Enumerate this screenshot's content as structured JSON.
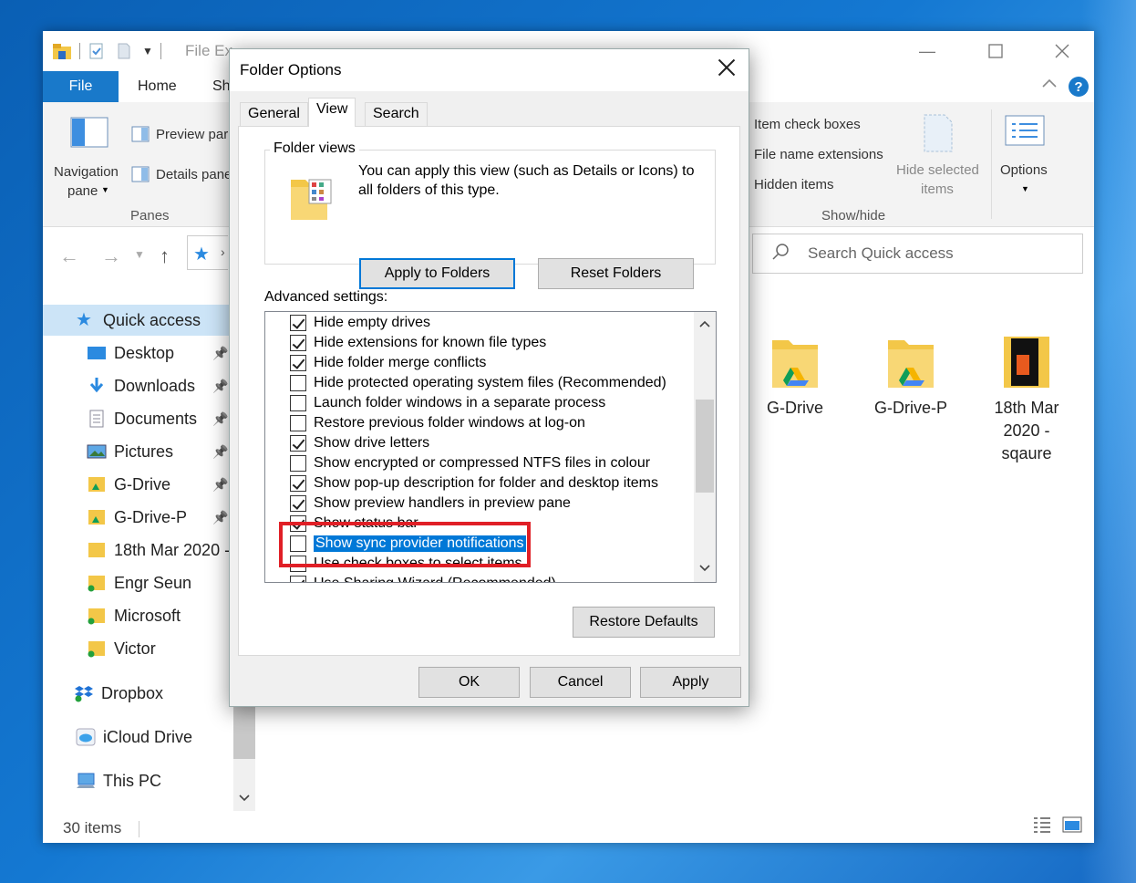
{
  "explorer": {
    "title": "File Ex",
    "tabs": {
      "file": "File",
      "home": "Home",
      "share": "Sh"
    },
    "ribbon": {
      "navigation_pane": "Navigation",
      "navigation_pane_2": "pane",
      "preview_pane": "Preview par",
      "details_pane": "Details pane",
      "panes_group": "Panes",
      "item_check_boxes": "Item check boxes",
      "file_name_extensions": "File name extensions",
      "hidden_items": "Hidden items",
      "hide_selected": "Hide selected",
      "hide_selected_2": "items",
      "options": "Options",
      "showhide_group": "Show/hide"
    },
    "search_placeholder": "Search Quick access",
    "nav": {
      "quick_access": "Quick access",
      "items": [
        {
          "label": "Desktop",
          "pinned": true
        },
        {
          "label": "Downloads",
          "pinned": true
        },
        {
          "label": "Documents",
          "pinned": true
        },
        {
          "label": "Pictures",
          "pinned": true
        },
        {
          "label": "G-Drive",
          "pinned": true
        },
        {
          "label": "G-Drive-P",
          "pinned": true
        },
        {
          "label": "18th Mar 2020 -",
          "pinned": false
        },
        {
          "label": "Engr Seun",
          "pinned": false
        },
        {
          "label": "Microsoft",
          "pinned": false
        },
        {
          "label": "Victor",
          "pinned": false
        }
      ],
      "dropbox": "Dropbox",
      "icloud": "iCloud Drive",
      "this_pc": "This PC"
    },
    "folders": [
      {
        "name": "G-Drive"
      },
      {
        "name": "G-Drive-P"
      },
      {
        "name": "18th Mar 2020 - sqaure"
      }
    ],
    "status": "30 items"
  },
  "dialog": {
    "title": "Folder Options",
    "tabs": [
      "General",
      "View",
      "Search"
    ],
    "active_tab": "View",
    "folder_views_label": "Folder views",
    "folder_views_text": "You can apply this view (such as Details or Icons) to all folders of this type.",
    "apply_to_folders": "Apply to Folders",
    "reset_folders": "Reset Folders",
    "advanced_label": "Advanced settings:",
    "settings": [
      {
        "label": "Hide empty drives",
        "checked": true
      },
      {
        "label": "Hide extensions for known file types",
        "checked": true
      },
      {
        "label": "Hide folder merge conflicts",
        "checked": true
      },
      {
        "label": "Hide protected operating system files (Recommended)",
        "checked": false
      },
      {
        "label": "Launch folder windows in a separate process",
        "checked": false
      },
      {
        "label": "Restore previous folder windows at log-on",
        "checked": false
      },
      {
        "label": "Show drive letters",
        "checked": true
      },
      {
        "label": "Show encrypted or compressed NTFS files in colour",
        "checked": false
      },
      {
        "label": "Show pop-up description for folder and desktop items",
        "checked": true
      },
      {
        "label": "Show preview handlers in preview pane",
        "checked": true
      },
      {
        "label": "Show status bar",
        "checked": true
      },
      {
        "label": "Show sync provider notifications",
        "checked": false,
        "selected": true
      },
      {
        "label": "Use check boxes to select items",
        "checked": false
      },
      {
        "label": "Use Sharing Wizard (Recommended)",
        "checked": true
      }
    ],
    "restore_defaults": "Restore Defaults",
    "ok": "OK",
    "cancel": "Cancel",
    "apply": "Apply"
  },
  "colors": {
    "accent": "#0078d7",
    "file_tab": "#1979ca",
    "highlight_box": "#e01f26"
  }
}
